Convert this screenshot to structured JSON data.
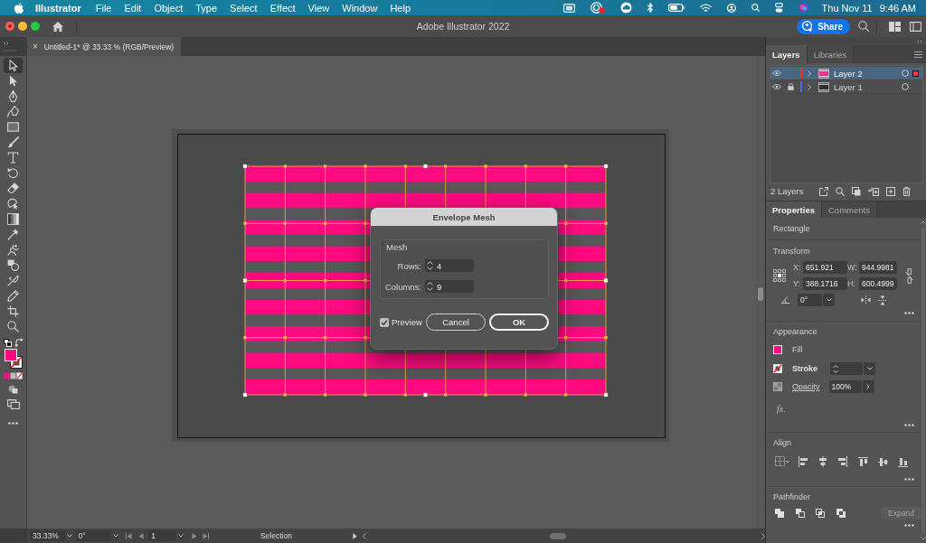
{
  "menu_bar": {
    "app_name": "Illustrator",
    "menus": [
      "File",
      "Edit",
      "Object",
      "Type",
      "Select",
      "Effect",
      "View",
      "Window",
      "Help"
    ],
    "date": "Thu Nov 11",
    "time": "9:46 AM"
  },
  "title_bar": {
    "title": "Adobe Illustrator 2022",
    "share_button": "Share"
  },
  "document_tab": {
    "close": "×",
    "title": "Untitled-1* @ 33.33 % (RGB/Preview)"
  },
  "toolbar": {
    "tools": [
      {
        "selected": true
      },
      {
        "selected": false
      },
      {
        "selected": false
      },
      {
        "selected": false
      },
      {
        "selected": false
      },
      {
        "selected": false
      },
      {
        "selected": false
      },
      {
        "selected": false
      },
      {
        "selected": false
      },
      {
        "selected": false
      },
      {
        "selected": false
      },
      {
        "selected": false
      },
      {
        "selected": false
      },
      {
        "selected": false
      },
      {
        "selected": false
      },
      {
        "selected": false
      },
      {
        "selected": false
      },
      {
        "selected": false
      }
    ]
  },
  "dialog": {
    "title": "Envelope Mesh",
    "group_label": "Mesh",
    "fields": [
      {
        "label": "Rows:",
        "value": "4"
      },
      {
        "label": "Columns:",
        "value": "9"
      }
    ],
    "preview": {
      "label": "Preview",
      "checked": true
    },
    "buttons": [
      {
        "label": "Cancel",
        "primary": false
      },
      {
        "label": "OK",
        "primary": true
      }
    ]
  },
  "layers_panel": {
    "tabs": [
      {
        "label": "Layers",
        "selected": true
      },
      {
        "label": "Libraries",
        "selected": false
      }
    ],
    "layers": [
      {
        "name": "Layer 2",
        "visible": true,
        "locked": false,
        "expanded": false,
        "color": "#ff3030",
        "selected": true
      },
      {
        "name": "Layer 1",
        "visible": true,
        "locked": true,
        "expanded": false,
        "color": "#4f66ff",
        "selected": false
      }
    ],
    "count": "2 Layers"
  },
  "properties_panel": {
    "tabs": [
      {
        "label": "Properties",
        "selected": true
      },
      {
        "label": "Comments",
        "selected": false
      }
    ],
    "object_type": "Rectangle",
    "transform": {
      "title": "Transform",
      "fields": [
        {
          "label": "X:",
          "value": "651.921"
        },
        {
          "label": "W:",
          "value": "944.9981"
        },
        {
          "label": "Y:",
          "value": "388.1716"
        },
        {
          "label": "H:",
          "value": "600.4999"
        }
      ],
      "angle": "0°"
    },
    "appearance": {
      "title": "Appearance",
      "fill_label": "Fill",
      "stroke_label": "Stroke",
      "opacity_label": "Opacity",
      "opacity_value": "100%",
      "effects": "fx."
    },
    "align": {
      "title": "Align"
    },
    "pathfinder": {
      "title": "Pathfinder",
      "expand_button": {
        "label": "Expand",
        "disabled": true
      }
    }
  },
  "status_bar": {
    "zoom": "33.33%",
    "rotation": "0°",
    "artboard": "1",
    "tool": "Selection"
  }
}
